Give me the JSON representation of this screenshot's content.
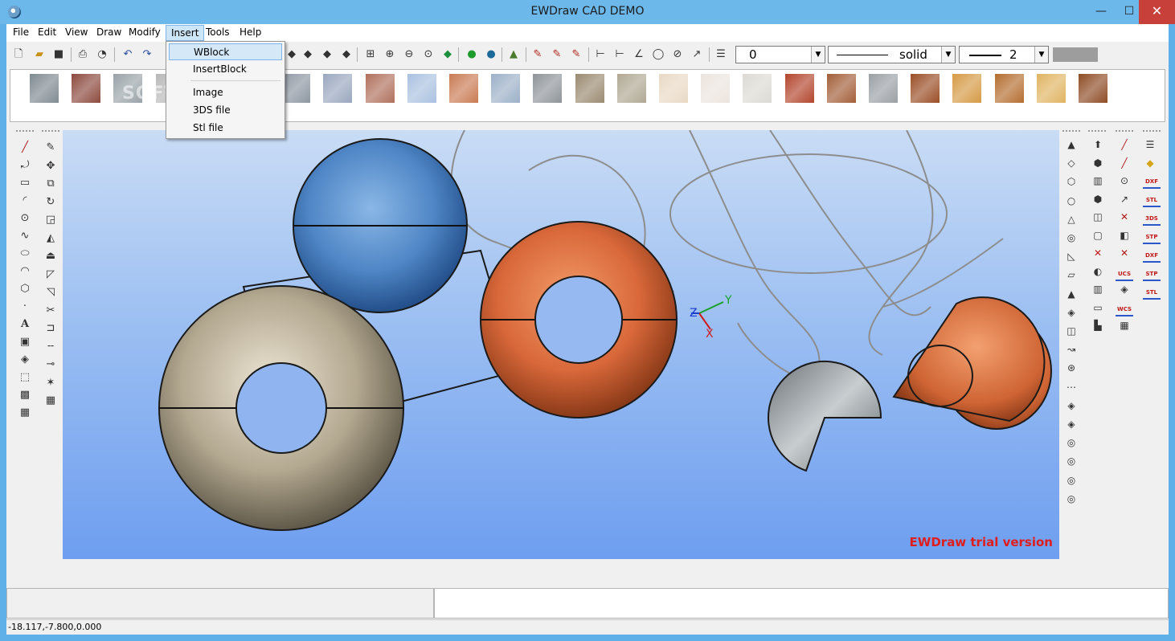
{
  "window": {
    "title": "EWDraw CAD DEMO",
    "minimize": "—",
    "maximize": "☐",
    "close": "✕"
  },
  "menubar": {
    "items": [
      "File",
      "Edit",
      "View",
      "Draw",
      "Modify",
      "Insert",
      "Tools",
      "Help"
    ],
    "active": "Insert"
  },
  "insert_menu": {
    "items": [
      "WBlock",
      "InsertBlock",
      "Image",
      "3DS file",
      "Stl file"
    ],
    "highlighted": "WBlock"
  },
  "toolbar": {
    "layer_value": "0",
    "linetype_value": "solid",
    "lineweight_value": "2",
    "color_value": "#9d9d9d"
  },
  "materials": {
    "swatches": [
      "#7f8a92",
      "#8c4a3e",
      "#9aa3a8",
      "#b8b8b8",
      "#a6a6a6",
      "#c0c0c0",
      "#8d96a1",
      "#9aa7bf",
      "#b0705c",
      "#a9c1e0",
      "#c97b54",
      "#9cb0c8",
      "#8e949a",
      "#9a8a70",
      "#b0a893",
      "#e9d9c5",
      "#ece4de",
      "#dcdad3",
      "#b3452d",
      "#a25e38",
      "#9aa0a5",
      "#9a4e26",
      "#d59a45",
      "#b46d2f",
      "#e0b462",
      "#8e4c25"
    ]
  },
  "viewport": {
    "trial_label": "EWDraw trial version",
    "watermark": "SOFTPEDIA",
    "axis_x": "X",
    "axis_y": "Y",
    "axis_z": "Z"
  },
  "right_toolbar": {
    "labels": [
      "DXF",
      "STL",
      "3DS",
      "STP",
      "DXF",
      "STP",
      "STL",
      "UCS",
      "WCS"
    ]
  },
  "statusbar": {
    "coordinates": "-18.117,-7.800,0.000"
  },
  "icons": {
    "toolbar": [
      "new-icon",
      "open-icon",
      "save-icon",
      "print-icon",
      "print-preview-icon",
      "undo-icon",
      "redo-icon"
    ],
    "left_col1": [
      "line-icon",
      "polyline-icon",
      "rectangle-icon",
      "arc-icon",
      "circle-icon",
      "spline-icon",
      "ellipse-icon",
      "ellipse-arc-icon",
      "polygon-icon",
      "point-icon",
      "text-icon",
      "image-icon",
      "block-icon",
      "insert-block-icon",
      "hatch-icon",
      "gradient-icon"
    ],
    "left_col2": [
      "erase-icon",
      "move-icon",
      "copy-icon",
      "rotate-icon",
      "scale-icon",
      "mirror-icon",
      "stretch-icon",
      "fillet-icon",
      "chamfer-icon",
      "trim-icon",
      "extend-icon",
      "break-icon",
      "join-icon",
      "explode-icon",
      "array-icon"
    ]
  }
}
